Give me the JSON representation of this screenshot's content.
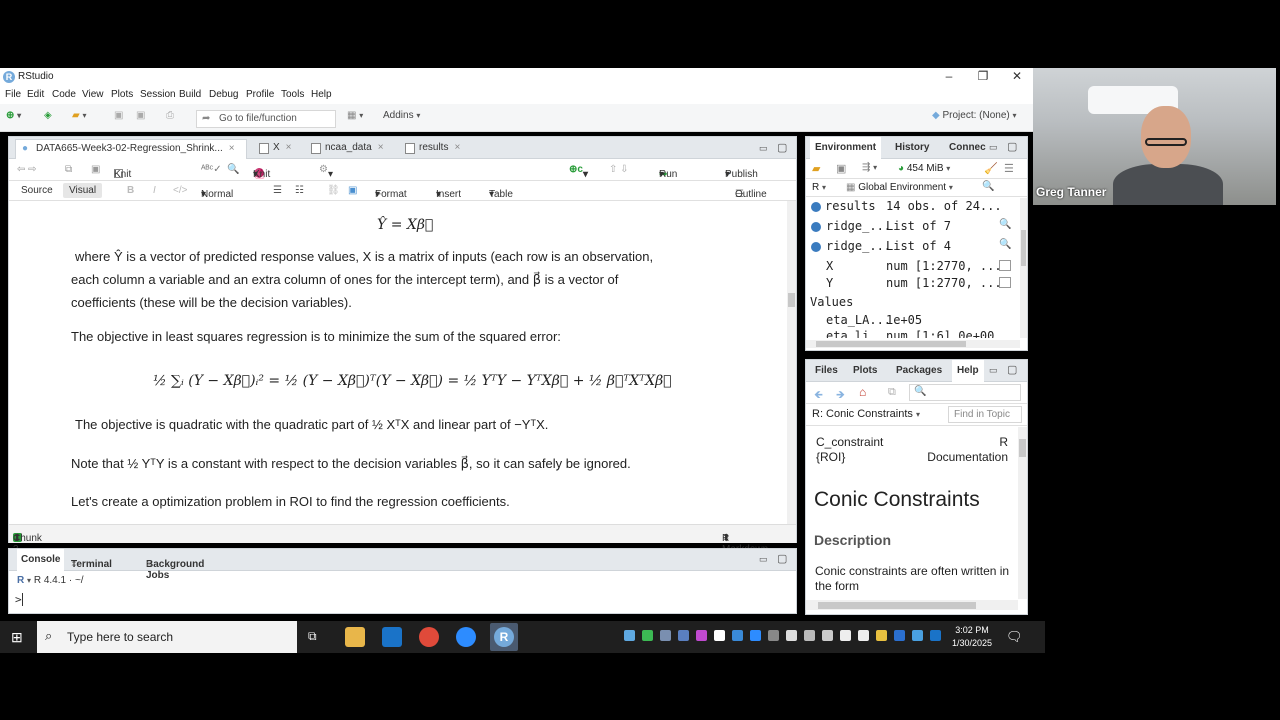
{
  "window": {
    "title": "RStudio",
    "app_icon": "R"
  },
  "menu": [
    "File",
    "Edit",
    "Code",
    "View",
    "Plots",
    "Session",
    "Build",
    "Debug",
    "Profile",
    "Tools",
    "Help"
  ],
  "toolbar": {
    "goto_placeholder": "Go to file/function",
    "addins": "Addins",
    "project": "Project: (None)"
  },
  "editor": {
    "tabs": [
      {
        "label": "DATA665-Week3-02-Regression_Shrink...",
        "active": true
      },
      {
        "label": "X"
      },
      {
        "label": "ncaa_data"
      },
      {
        "label": "results"
      }
    ],
    "toolbar": {
      "knit_on_save": "Knit on Save",
      "knit": "Knit",
      "run": "Run",
      "publish": "Publish"
    },
    "format_bar": {
      "source": "Source",
      "visual": "Visual",
      "normal": "Normal",
      "format": "Format",
      "insert": "Insert",
      "table": "Table",
      "outline": "Outline"
    },
    "doc": {
      "eq1": "Ŷ = Xβ⃗",
      "line1": "where Ŷ is a vector of predicted response values, X is a matrix of inputs (each row is an observation,",
      "line2": "each column a variable and an extra column of ones for the intercept term), and β⃗ is a vector of",
      "line3": "coefficients (these will be the decision variables).",
      "line4": "The objective in least squares regression is to minimize the sum of the squared error:",
      "eq2": "½ ∑ᵢ (Y − Xβ⃗)ᵢ² = ½ (Y − Xβ⃗)ᵀ(Y − Xβ⃗) = ½ YᵀY − YᵀXβ⃗ + ½ β⃗ᵀXᵀXβ⃗",
      "line5": "The objective is quadratic with the quadratic part of ½ XᵀX and linear part of −YᵀX.",
      "line6": "Note that ½ YᵀY is a constant with respect to the decision variables β⃗, so it can safely be ignored.",
      "line7": "Let's create a optimization problem in ROI to find the regression coefficients."
    },
    "status": {
      "chunk": "Chunk 3",
      "mode": "R Markdown"
    }
  },
  "console": {
    "tabs": [
      "Console",
      "Terminal",
      "Background Jobs"
    ],
    "version": "R 4.4.1 · ~/",
    "prompt": ">"
  },
  "environment": {
    "tabs": [
      "Environment",
      "History",
      "Connec"
    ],
    "memory": "454 MiB",
    "lang": "R",
    "scope": "Global Environment",
    "rows": [
      {
        "name": "results",
        "value": "14 obs. of 24..."
      },
      {
        "name": "ridge_...",
        "value": "List of  7"
      },
      {
        "name": "ridge_...",
        "value": "List of  4"
      },
      {
        "name": "X",
        "value": "num [1:2770, ..."
      },
      {
        "name": "Y",
        "value": "num [1:2770, ..."
      }
    ],
    "values_header": "Values",
    "values": [
      {
        "name": "eta_LA...",
        "value": "1e+05"
      },
      {
        "name": "eta_li...",
        "value": "num [1:6] 0e+00..."
      }
    ]
  },
  "help": {
    "tabs": [
      "Files",
      "Plots",
      "Packages",
      "Help"
    ],
    "topic": "R: Conic Constraints",
    "find_placeholder": "Find in Topic",
    "header_left": "C_constraint {ROI}",
    "header_right": "R Documentation",
    "title": "Conic Constraints",
    "section": "Description",
    "body": "Conic constraints are often written in the form"
  },
  "webcam": {
    "name": "Greg Tanner"
  },
  "taskbar": {
    "search": "Type here to search",
    "time": "3:02 PM",
    "date": "1/30/2025"
  }
}
